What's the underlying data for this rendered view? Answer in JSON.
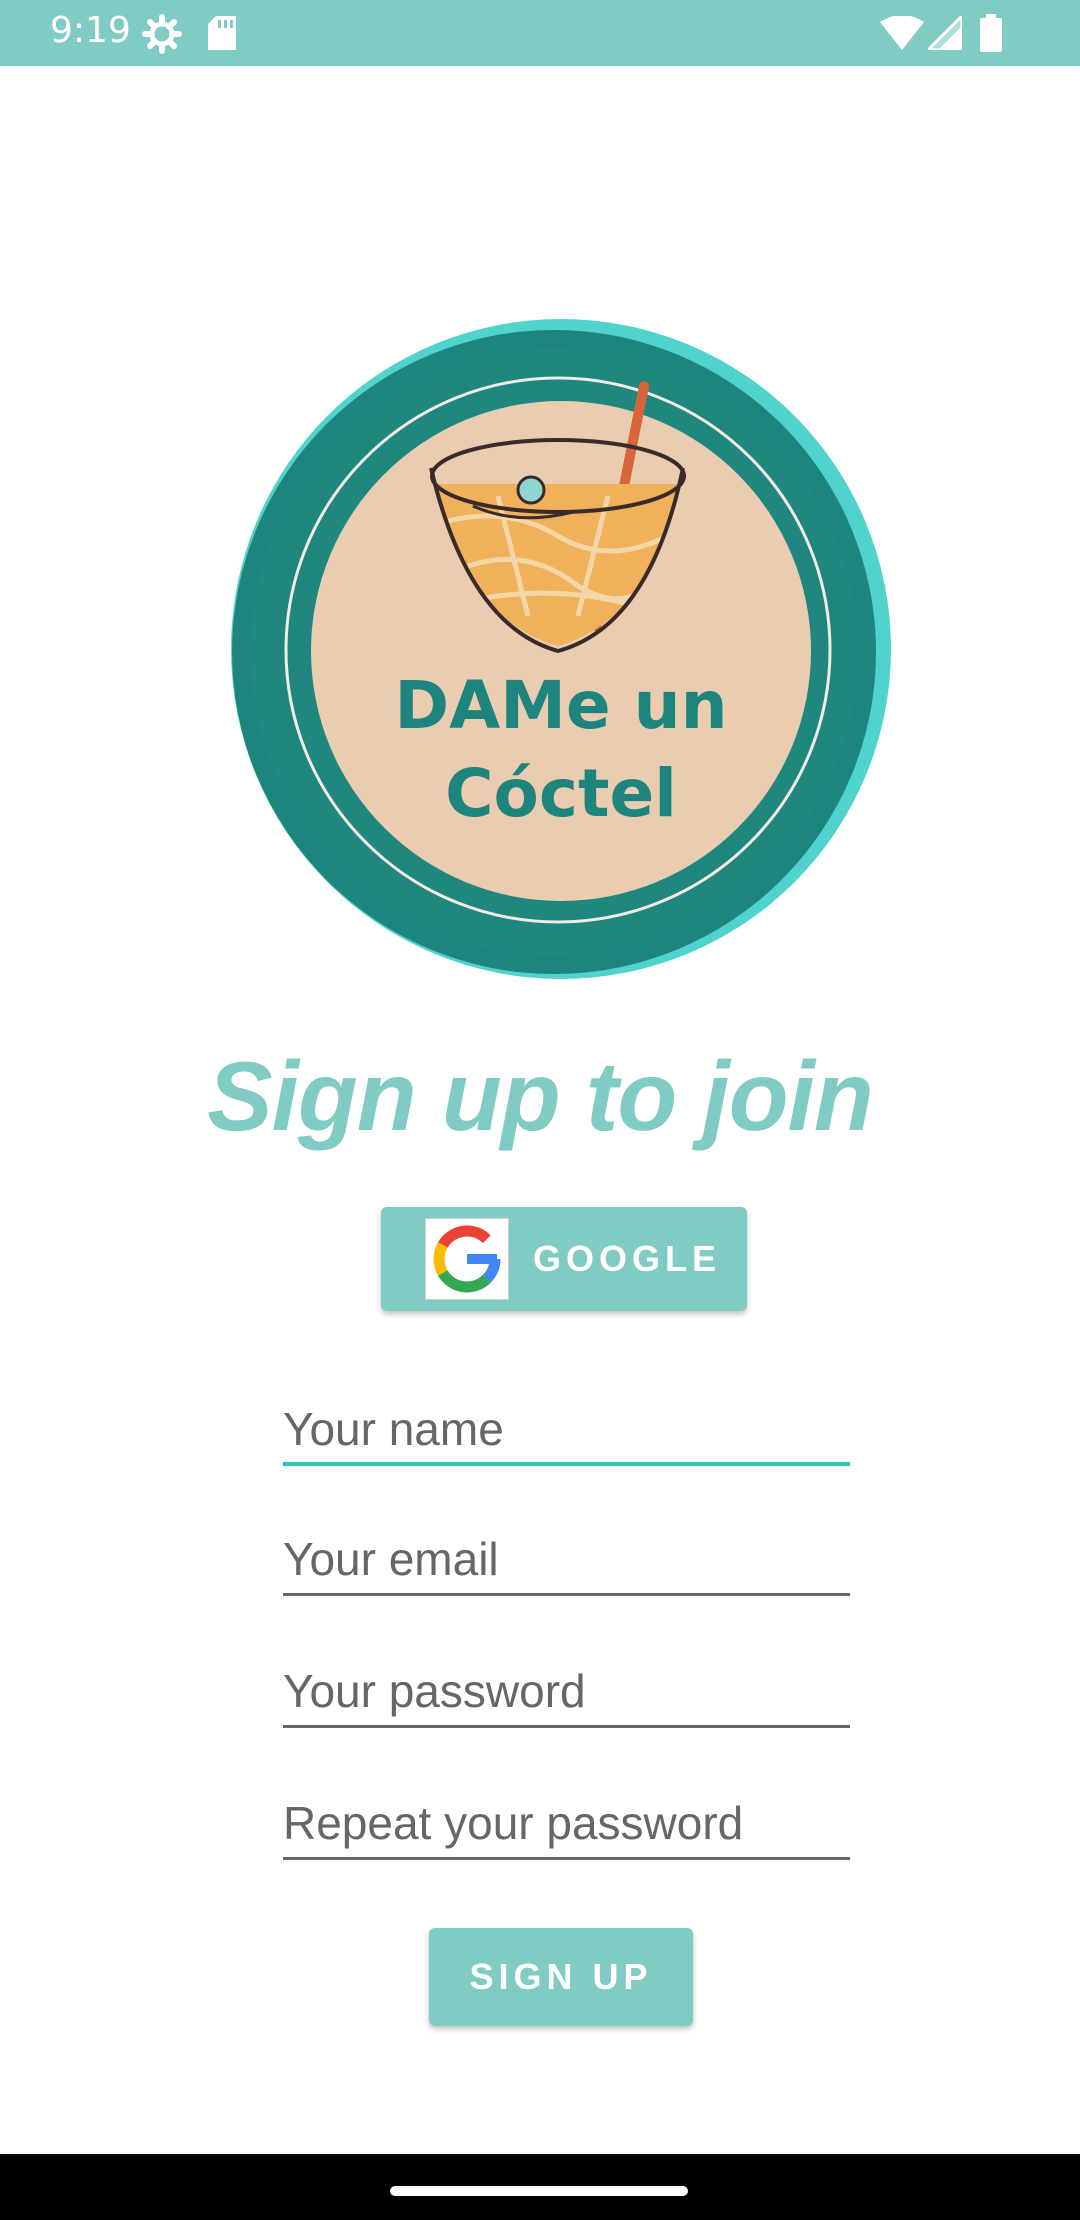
{
  "status_bar": {
    "time": "9:19",
    "icons": [
      "settings-icon",
      "sd-card-icon",
      "wifi-icon",
      "signal-icon",
      "battery-icon"
    ]
  },
  "logo": {
    "line1": "DAMe un",
    "line2": "Cóctel"
  },
  "page_title": "Sign up to join",
  "google_button": {
    "label": "GOOGLE"
  },
  "form": {
    "name_placeholder": "Your name",
    "email_placeholder": "Your email",
    "password_placeholder": "Your password",
    "repeat_password_placeholder": "Repeat your password"
  },
  "signup_button": {
    "label": "SIGN UP"
  },
  "colors": {
    "accent": "#80CBC4",
    "focus_underline": "#26C6B8",
    "logo_ring": "#1E857E",
    "logo_fill": "#EACDB1"
  }
}
